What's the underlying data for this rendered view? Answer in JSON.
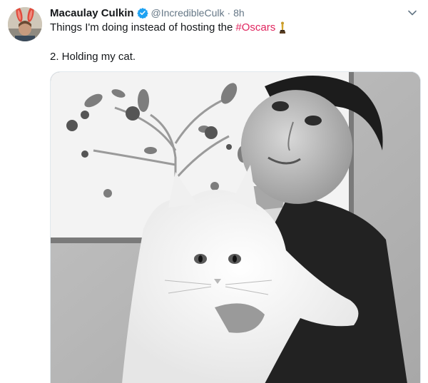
{
  "tweet": {
    "author_name": "Macaulay Culkin",
    "handle": "@IncredibleCulk",
    "separator": "·",
    "time": "8h",
    "text_line1": "Things I'm doing instead of hosting the",
    "hashtag": "#Oscars",
    "text_line2": "2. Holding my cat."
  },
  "icons": {
    "verified": "verified-badge-icon",
    "more": "chevron-down-icon",
    "emoji": "oscar-trophy-icon"
  },
  "colors": {
    "hashtag": "#e0245e",
    "verified": "#1da1f2",
    "secondary_text": "#657786"
  }
}
